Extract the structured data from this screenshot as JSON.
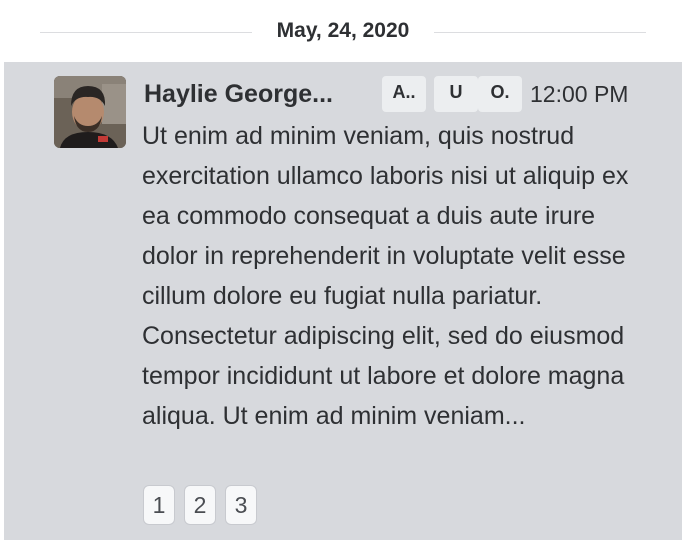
{
  "date_separator": {
    "label": "May, 24, 2020"
  },
  "message": {
    "author_name": "Haylie George...",
    "badges": [
      {
        "label": "A.."
      },
      {
        "label": "U"
      },
      {
        "label": "O."
      }
    ],
    "time": "12:00 PM",
    "text": "Ut enim ad minim veniam, quis nostrud exercitation ullamco laboris nisi ut aliquip ex ea commodo consequat a duis aute irure dolor in reprehenderit in voluptate velit esse cillum dolore eu fugiat nulla pariatur. Consectetur adipiscing elit, sed do eiusmod tempor incididunt ut labore et dolore magna aliqua. Ut enim ad minim veniam...",
    "pages": [
      {
        "label": "1"
      },
      {
        "label": "2"
      },
      {
        "label": "3"
      }
    ]
  },
  "colors": {
    "message_background": "#d7d9dd",
    "text": "#2e3033",
    "badge_background": "#eceef0"
  }
}
